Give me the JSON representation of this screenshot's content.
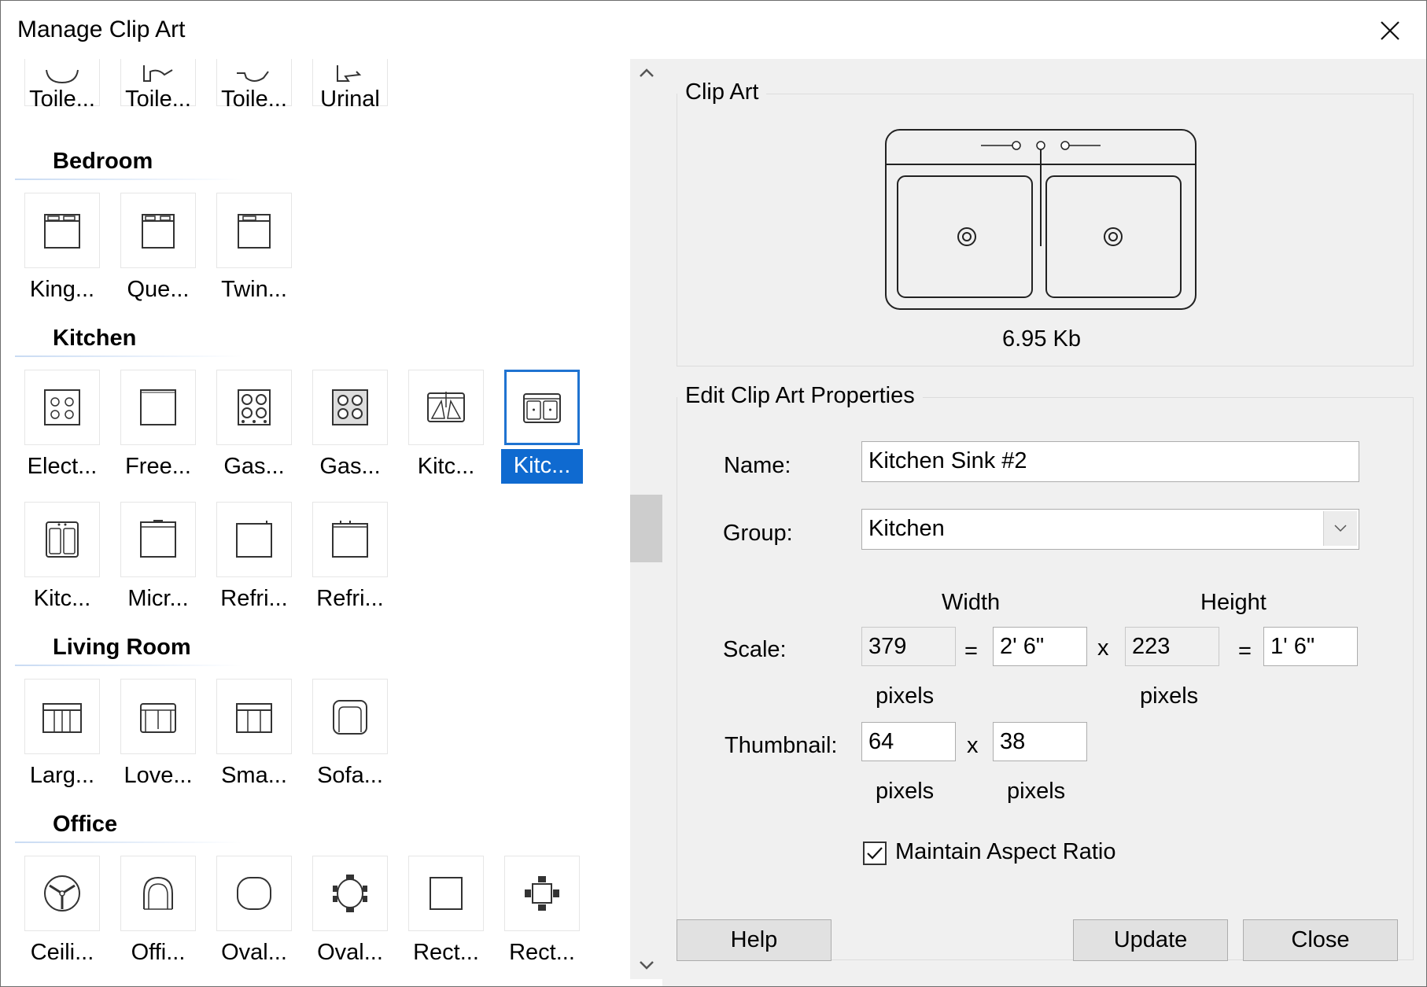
{
  "window": {
    "title": "Manage Clip Art",
    "close_icon": "close-icon"
  },
  "clipart_list": {
    "groups": [
      {
        "name": "",
        "items": [
          {
            "label": "Toile...",
            "icon": "toilet-icon"
          },
          {
            "label": "Toile...",
            "icon": "toilet-icon"
          },
          {
            "label": "Toile...",
            "icon": "toilet-icon"
          },
          {
            "label": "Urinal",
            "icon": "urinal-icon"
          }
        ]
      },
      {
        "name": "Bedroom",
        "items": [
          {
            "label": "King...",
            "icon": "bed-icon"
          },
          {
            "label": "Que...",
            "icon": "bed-icon"
          },
          {
            "label": "Twin...",
            "icon": "bed-icon"
          }
        ]
      },
      {
        "name": "Kitchen",
        "items": [
          {
            "label": "Elect...",
            "icon": "electric-stove-icon"
          },
          {
            "label": "Free...",
            "icon": "freezer-icon"
          },
          {
            "label": "Gas...",
            "icon": "gas-range-icon"
          },
          {
            "label": "Gas...",
            "icon": "gas-range-icon"
          },
          {
            "label": "Kitc...",
            "icon": "kitchen-sink-icon"
          },
          {
            "label": "Kitc...",
            "icon": "kitchen-sink-icon",
            "selected": true
          },
          {
            "label": "Kitc...",
            "icon": "kitchen-sink-icon"
          },
          {
            "label": "Micr...",
            "icon": "microwave-icon"
          },
          {
            "label": "Refri...",
            "icon": "refrigerator-icon"
          },
          {
            "label": "Refri...",
            "icon": "refrigerator-icon"
          }
        ]
      },
      {
        "name": "Living Room",
        "items": [
          {
            "label": "Larg...",
            "icon": "sofa-icon"
          },
          {
            "label": "Love...",
            "icon": "loveseat-icon"
          },
          {
            "label": "Sma...",
            "icon": "sofa-icon"
          },
          {
            "label": "Sofa...",
            "icon": "armchair-icon"
          }
        ]
      },
      {
        "name": "Office",
        "items": [
          {
            "label": "Ceili...",
            "icon": "ceiling-fan-icon"
          },
          {
            "label": "Offi...",
            "icon": "office-chair-icon"
          },
          {
            "label": "Oval...",
            "icon": "oval-table-icon"
          },
          {
            "label": "Oval...",
            "icon": "oval-table-chairs-icon"
          },
          {
            "label": "Rect...",
            "icon": "rectangle-table-icon"
          },
          {
            "label": "Rect...",
            "icon": "rectangle-table-chairs-icon"
          }
        ]
      }
    ]
  },
  "scrollbar": {
    "up_icon": "chevron-up-icon",
    "down_icon": "chevron-down-icon"
  },
  "preview": {
    "title": "Clip Art",
    "file_size": "6.95 Kb"
  },
  "properties": {
    "title": "Edit Clip Art Properties",
    "name_label": "Name:",
    "name_value": "Kitchen Sink #2",
    "group_label": "Group:",
    "group_value": "Kitchen",
    "width_header": "Width",
    "height_header": "Height",
    "scale_label": "Scale:",
    "scale_width_pixels": "379",
    "equals": "=",
    "scale_width_size": "2' 6\"",
    "times": "x",
    "scale_height_pixels": "223",
    "scale_height_size": "1' 6\"",
    "pixels_label": "pixels",
    "thumbnail_label": "Thumbnail:",
    "thumbnail_width": "64",
    "thumbnail_height": "38",
    "maintain_aspect_ratio_label": "Maintain Aspect Ratio",
    "maintain_aspect_ratio_checked": true
  },
  "buttons": {
    "help": "Help",
    "update": "Update",
    "close": "Close"
  }
}
